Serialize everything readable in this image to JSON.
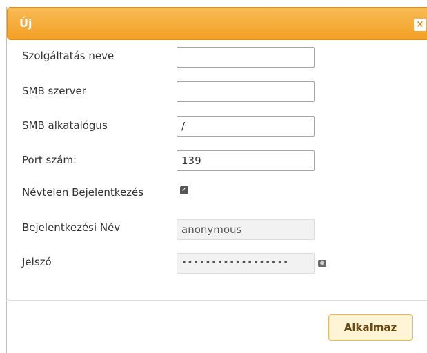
{
  "dialog": {
    "title": "Új",
    "close_label": "×"
  },
  "form": {
    "service_name": {
      "label": "Szolgáltatás neve",
      "value": ""
    },
    "smb_server": {
      "label": "SMB szerver",
      "value": ""
    },
    "smb_subdir": {
      "label": "SMB alkatalógus",
      "value": "/"
    },
    "port": {
      "label": "Port szám:",
      "value": "139"
    },
    "anonymous_login": {
      "label": "Névtelen Bejelentkezés",
      "checked": true,
      "check_glyph": "✓"
    },
    "login_name": {
      "label": "Bejelentkezési Név",
      "value": "anonymous",
      "disabled": true
    },
    "password": {
      "label": "Jelszó",
      "value": "••••••••••••••••••",
      "disabled": true
    }
  },
  "footer": {
    "apply_label": "Alkalmaz"
  },
  "icons": {
    "close": "close-icon",
    "reveal_password": "eye-icon",
    "checkbox": "checkmark-icon"
  },
  "colors": {
    "titlebar": "#f3a024",
    "apply_button_bg": "#fff5d6",
    "apply_button_border": "#f0b84a"
  }
}
